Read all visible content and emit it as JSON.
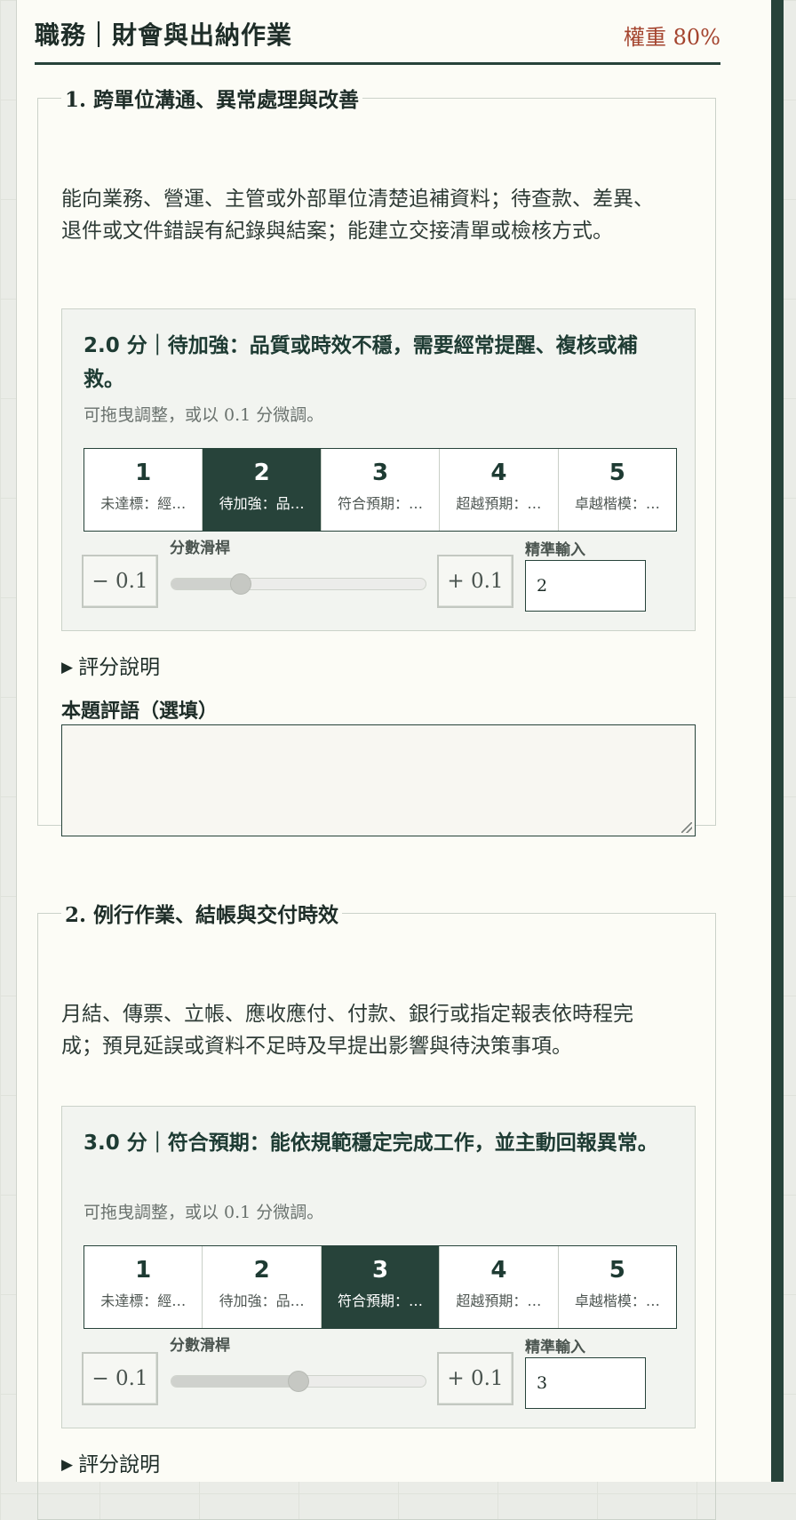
{
  "header": {
    "title": "職務｜財會與出納作業",
    "weight": "權重 80%"
  },
  "criteria": [
    {
      "legend": "1. 跨單位溝通、異常處理與改善",
      "description": "能向業務、營運、主管或外部單位清楚追補資料；待查款、差異、退件或文件錯誤有紀錄與結案；能建立交接清單或檢核方式。",
      "score_heading": "2.0 分｜待加強：品質或時效不穩，需要經常提醒、複核或補救。",
      "hint": "可拖曳調整，或以 0.1 分微調。",
      "levels": [
        {
          "num": "1",
          "label": "未達標：經…"
        },
        {
          "num": "2",
          "label": "待加強：品…"
        },
        {
          "num": "3",
          "label": "符合預期：…"
        },
        {
          "num": "4",
          "label": "超越預期：…"
        },
        {
          "num": "5",
          "label": "卓越楷模：…"
        }
      ],
      "active_level": 2,
      "score": 2,
      "slider_min": 1,
      "slider_max": 5,
      "minus_label": "− 0.1",
      "plus_label": "+ 0.1",
      "slider_label": "分數滑桿",
      "exact_label": "精準輸入",
      "exact_value": "2",
      "details_label": "評分說明",
      "comment_label": "本題評語（選填）"
    },
    {
      "legend": "2. 例行作業、結帳與交付時效",
      "description": "月結、傳票、立帳、應收應付、付款、銀行或指定報表依時程完成；預見延誤或資料不足時及早提出影響與待決策事項。",
      "score_heading": "3.0 分｜符合預期：能依規範穩定完成工作，並主動回報異常。",
      "hint": "可拖曳調整，或以 0.1 分微調。",
      "levels": [
        {
          "num": "1",
          "label": "未達標：經…"
        },
        {
          "num": "2",
          "label": "待加強：品…"
        },
        {
          "num": "3",
          "label": "符合預期：…"
        },
        {
          "num": "4",
          "label": "超越預期：…"
        },
        {
          "num": "5",
          "label": "卓越楷模：…"
        }
      ],
      "active_level": 3,
      "score": 3,
      "slider_min": 1,
      "slider_max": 5,
      "minus_label": "− 0.1",
      "plus_label": "+ 0.1",
      "slider_label": "分數滑桿",
      "exact_label": "精準輸入",
      "exact_value": "3",
      "details_label": "評分說明"
    }
  ]
}
